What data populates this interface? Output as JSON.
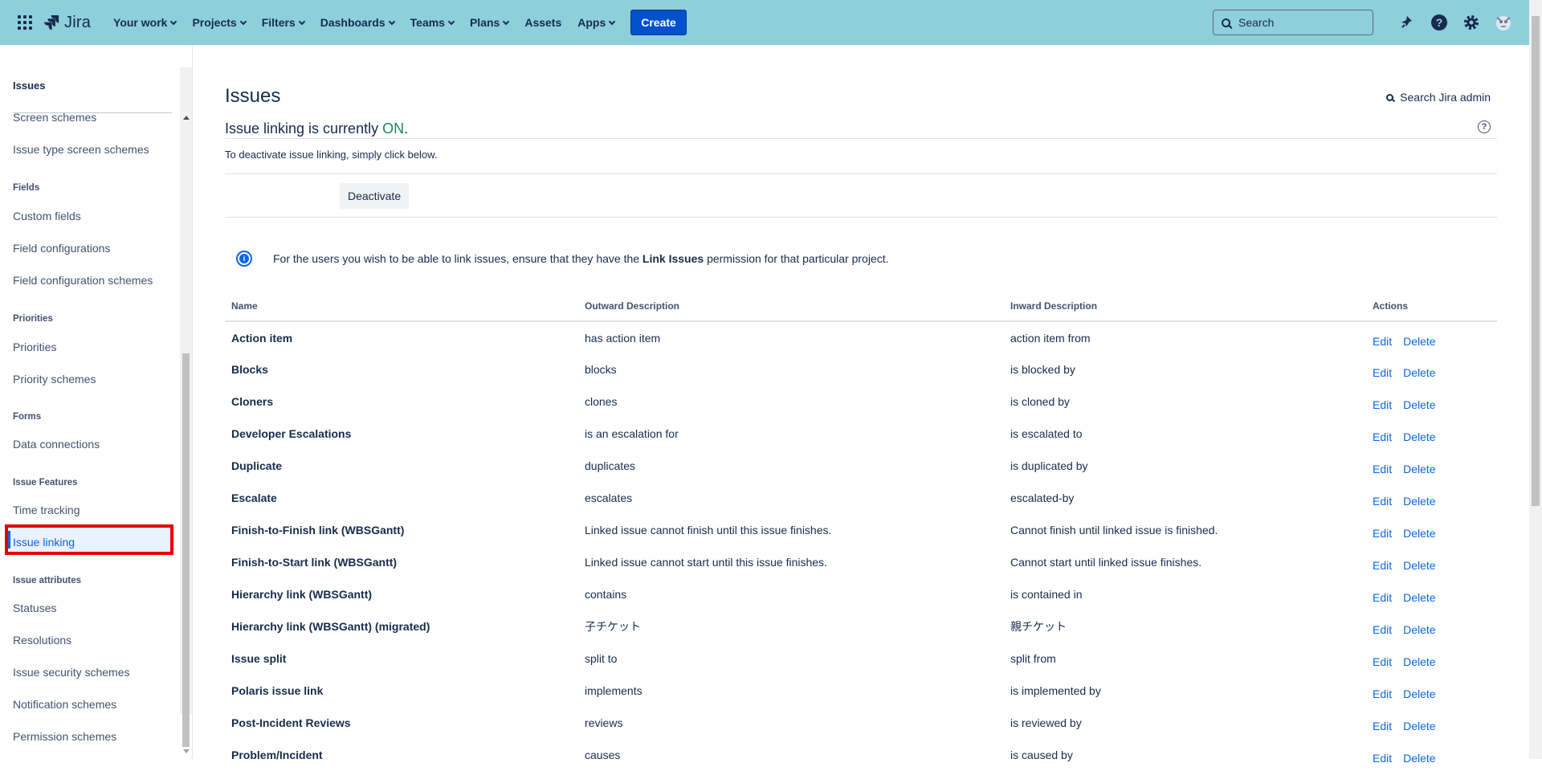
{
  "topbar": {
    "app_name": "Jira",
    "nav": [
      "Your work",
      "Projects",
      "Filters",
      "Dashboards",
      "Teams",
      "Plans",
      "Assets",
      "Apps"
    ],
    "create_label": "Create",
    "search_placeholder": "Search",
    "icons": [
      "app-switcher-icon",
      "notification-icon",
      "help-icon",
      "settings-icon",
      "avatar"
    ]
  },
  "sidebar": {
    "heading": "Issues",
    "items": [
      {
        "type": "item",
        "label": "Screen schemes"
      },
      {
        "type": "item",
        "label": "Issue type screen schemes"
      },
      {
        "type": "group",
        "label": "Fields"
      },
      {
        "type": "item",
        "label": "Custom fields"
      },
      {
        "type": "item",
        "label": "Field configurations"
      },
      {
        "type": "item",
        "label": "Field configuration schemes"
      },
      {
        "type": "group",
        "label": "Priorities"
      },
      {
        "type": "item",
        "label": "Priorities"
      },
      {
        "type": "item",
        "label": "Priority schemes"
      },
      {
        "type": "group",
        "label": "Forms"
      },
      {
        "type": "item",
        "label": "Data connections"
      },
      {
        "type": "group",
        "label": "Issue Features"
      },
      {
        "type": "item",
        "label": "Time tracking"
      },
      {
        "type": "item",
        "label": "Issue linking",
        "active": true
      },
      {
        "type": "group",
        "label": "Issue attributes"
      },
      {
        "type": "item",
        "label": "Statuses"
      },
      {
        "type": "item",
        "label": "Resolutions"
      },
      {
        "type": "item",
        "label": "Issue security schemes"
      },
      {
        "type": "item",
        "label": "Notification schemes"
      },
      {
        "type": "item",
        "label": "Permission schemes"
      }
    ]
  },
  "main": {
    "title": "Issues",
    "admin_search": "Search Jira admin",
    "status_prefix": "Issue linking is currently ",
    "status_value": "ON",
    "status_suffix": ".",
    "deactivate_text": "To deactivate issue linking, simply click below.",
    "deactivate_button": "Deactivate",
    "info_prefix": "For the users you wish to be able to link issues, ensure that they have the ",
    "info_bold": "Link Issues",
    "info_suffix": " permission for that particular project.",
    "columns": [
      "Name",
      "Outward Description",
      "Inward Description",
      "Actions"
    ],
    "edit_label": "Edit",
    "delete_label": "Delete",
    "rows": [
      {
        "name": "Action item",
        "outward": "has action item",
        "inward": "action item from"
      },
      {
        "name": "Blocks",
        "outward": "blocks",
        "inward": "is blocked by"
      },
      {
        "name": "Cloners",
        "outward": "clones",
        "inward": "is cloned by"
      },
      {
        "name": "Developer Escalations",
        "outward": "is an escalation for",
        "inward": "is escalated to"
      },
      {
        "name": "Duplicate",
        "outward": "duplicates",
        "inward": "is duplicated by"
      },
      {
        "name": "Escalate",
        "outward": "escalates",
        "inward": "escalated-by"
      },
      {
        "name": "Finish-to-Finish link (WBSGantt)",
        "outward": "Linked issue cannot finish until this issue finishes.",
        "inward": "Cannot finish until linked issue is finished."
      },
      {
        "name": "Finish-to-Start link (WBSGantt)",
        "outward": "Linked issue cannot start until this issue finishes.",
        "inward": "Cannot start until linked issue finishes."
      },
      {
        "name": "Hierarchy link (WBSGantt)",
        "outward": "contains",
        "inward": "is contained in"
      },
      {
        "name": "Hierarchy link (WBSGantt) (migrated)",
        "outward": "子チケット",
        "inward": "親チケット"
      },
      {
        "name": "Issue split",
        "outward": "split to",
        "inward": "split from"
      },
      {
        "name": "Polaris issue link",
        "outward": "implements",
        "inward": "is implemented by"
      },
      {
        "name": "Post-Incident Reviews",
        "outward": "reviews",
        "inward": "is reviewed by"
      },
      {
        "name": "Problem/Incident",
        "outward": "causes",
        "inward": "is caused by"
      }
    ]
  }
}
